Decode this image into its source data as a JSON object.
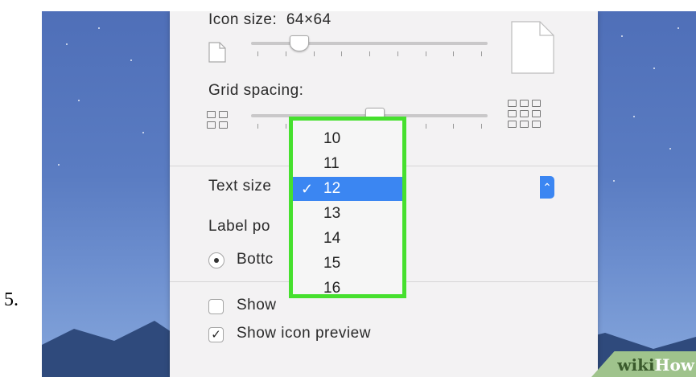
{
  "step_number": "5.",
  "panel": {
    "icon_size_label": "Icon size:",
    "icon_size_value": "64×64",
    "icon_size_slider_fraction": 0.2,
    "grid_spacing_label": "Grid spacing:",
    "grid_spacing_slider_fraction": 0.52,
    "text_size_label": "Text size",
    "label_position_label": "Label po",
    "bottom_option_label": "Bottc",
    "show_item_info_label": "Show",
    "show_icon_preview_label": "Show icon preview",
    "show_item_info_checked": false,
    "show_icon_preview_checked": true
  },
  "text_size_menu": {
    "options": [
      "10",
      "11",
      "12",
      "13",
      "14",
      "15",
      "16"
    ],
    "selected": "12",
    "checkmark": "✓",
    "highlight_color": "#46e02e"
  },
  "watermark": {
    "wiki": "wiki",
    "how": "How"
  }
}
